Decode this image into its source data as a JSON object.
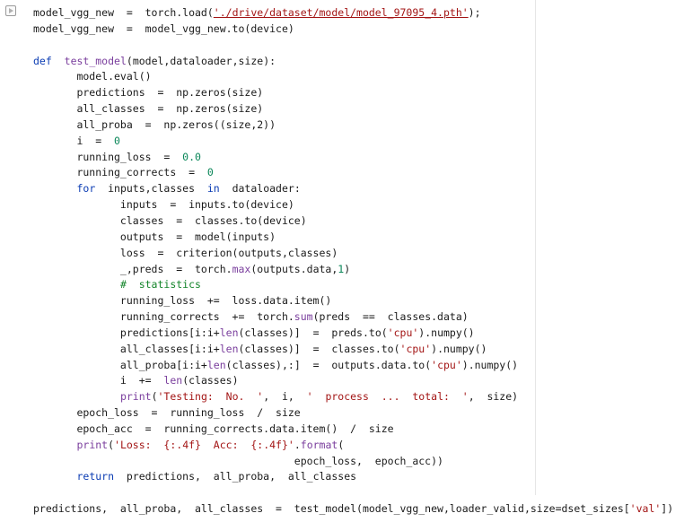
{
  "cell": {
    "run_button": "run-cell",
    "lines": [
      [
        {
          "t": "model_vgg_new  =  torch.load("
        },
        {
          "t": "'./drive/dataset/model/model_97095_4.pth'",
          "c": "link"
        },
        {
          "t": ");"
        }
      ],
      [
        {
          "t": "model_vgg_new  =  model_vgg_new.to(device)"
        }
      ],
      [],
      [
        {
          "t": "def",
          "c": "kw"
        },
        {
          "t": "  "
        },
        {
          "t": "test_model",
          "c": "fn"
        },
        {
          "t": "(model,dataloader,size):"
        }
      ],
      [
        {
          "t": "       model.eval()"
        }
      ],
      [
        {
          "t": "       predictions  =  np.zeros(size)"
        }
      ],
      [
        {
          "t": "       all_classes  =  np.zeros(size)"
        }
      ],
      [
        {
          "t": "       all_proba  =  np.zeros((size,2))"
        }
      ],
      [
        {
          "t": "       i  =  "
        },
        {
          "t": "0",
          "c": "num"
        }
      ],
      [
        {
          "t": "       running_loss  =  "
        },
        {
          "t": "0.0",
          "c": "num"
        }
      ],
      [
        {
          "t": "       running_corrects  =  "
        },
        {
          "t": "0",
          "c": "num"
        }
      ],
      [
        {
          "t": "       "
        },
        {
          "t": "for",
          "c": "kw"
        },
        {
          "t": "  inputs,classes  "
        },
        {
          "t": "in",
          "c": "kw"
        },
        {
          "t": "  dataloader:"
        }
      ],
      [
        {
          "t": "              inputs  =  inputs.to(device)"
        }
      ],
      [
        {
          "t": "              classes  =  classes.to(device)"
        }
      ],
      [
        {
          "t": "              outputs  =  model(inputs)"
        }
      ],
      [
        {
          "t": "              loss  =  criterion(outputs,classes)"
        }
      ],
      [
        {
          "t": "              _,preds  =  torch."
        },
        {
          "t": "max",
          "c": "fn"
        },
        {
          "t": "(outputs.data,"
        },
        {
          "t": "1",
          "c": "num"
        },
        {
          "t": ")"
        }
      ],
      [
        {
          "t": "              "
        },
        {
          "t": "#  statistics",
          "c": "cmt"
        }
      ],
      [
        {
          "t": "              running_loss  +=  loss.data.item()"
        }
      ],
      [
        {
          "t": "              running_corrects  +=  torch."
        },
        {
          "t": "sum",
          "c": "fn"
        },
        {
          "t": "(preds  ==  classes.data)"
        }
      ],
      [
        {
          "t": "              predictions[i:i+"
        },
        {
          "t": "len",
          "c": "fn"
        },
        {
          "t": "(classes)]  =  preds.to("
        },
        {
          "t": "'cpu'",
          "c": "str"
        },
        {
          "t": ").numpy()"
        }
      ],
      [
        {
          "t": "              all_classes[i:i+"
        },
        {
          "t": "len",
          "c": "fn"
        },
        {
          "t": "(classes)]  =  classes.to("
        },
        {
          "t": "'cpu'",
          "c": "str"
        },
        {
          "t": ").numpy()"
        }
      ],
      [
        {
          "t": "              all_proba[i:i+"
        },
        {
          "t": "len",
          "c": "fn"
        },
        {
          "t": "(classes),:]  =  outputs.data.to("
        },
        {
          "t": "'cpu'",
          "c": "str"
        },
        {
          "t": ").numpy()"
        }
      ],
      [
        {
          "t": "              i  +=  "
        },
        {
          "t": "len",
          "c": "fn"
        },
        {
          "t": "(classes)"
        }
      ],
      [
        {
          "t": "              "
        },
        {
          "t": "print",
          "c": "fn"
        },
        {
          "t": "("
        },
        {
          "t": "'Testing:  No.  '",
          "c": "str"
        },
        {
          "t": ",  i,  "
        },
        {
          "t": "'  process  ...  total:  '",
          "c": "str"
        },
        {
          "t": ",  size)"
        }
      ],
      [
        {
          "t": "       epoch_loss  =  running_loss  /  size"
        }
      ],
      [
        {
          "t": "       epoch_acc  =  running_corrects.data.item()  /  size"
        }
      ],
      [
        {
          "t": "       "
        },
        {
          "t": "print",
          "c": "fn"
        },
        {
          "t": "("
        },
        {
          "t": "'Loss:  {:.4f}  Acc:  {:.4f}'",
          "c": "str"
        },
        {
          "t": "."
        },
        {
          "t": "format",
          "c": "fn"
        },
        {
          "t": "("
        }
      ],
      [
        {
          "t": "                                          epoch_loss,  epoch_acc))"
        }
      ],
      [
        {
          "t": "       "
        },
        {
          "t": "return",
          "c": "kw"
        },
        {
          "t": "  predictions,  all_proba,  all_classes"
        }
      ],
      [],
      [
        {
          "t": "predictions,  all_proba,  all_classes  =  test_model(model_vgg_new,loader_valid,size=dset_sizes["
        },
        {
          "t": "'val'",
          "c": "str"
        },
        {
          "t": "])"
        }
      ]
    ]
  }
}
